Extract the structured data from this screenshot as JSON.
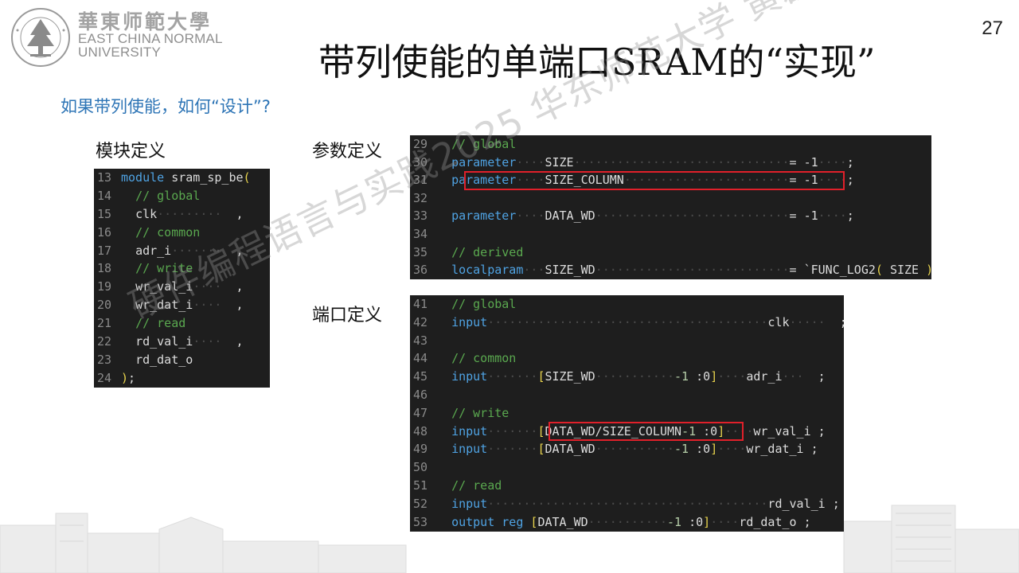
{
  "header": {
    "logo_cn": "華東师範大學",
    "logo_en_line1": "EAST CHINA NORMAL",
    "logo_en_line2": "UNIVERSITY",
    "page_number": "27"
  },
  "title": "带列使能的单端口SRAM的“实现”",
  "subtitle": "如果带列使能，如何“设计”?",
  "labels": {
    "module_def": "模块定义",
    "param_def": "参数定义",
    "port_def": "端口定义"
  },
  "watermark": "硬件编程语言与实践2025 华东师范大学 黄磊磊",
  "module_code": [
    {
      "ln": "13",
      "parts": [
        [
          "kw",
          "module "
        ],
        [
          "id",
          "sram_sp_be"
        ],
        [
          "yl",
          "("
        ]
      ]
    },
    {
      "ln": "14",
      "parts": [
        [
          "dots",
          "  "
        ],
        [
          "cm",
          "// global"
        ]
      ]
    },
    {
      "ln": "15",
      "parts": [
        [
          "dots",
          "  "
        ],
        [
          "id",
          "clk"
        ],
        [
          "dots",
          "·········"
        ],
        [
          "id",
          "  ,"
        ]
      ]
    },
    {
      "ln": "16",
      "parts": [
        [
          "dots",
          "  "
        ],
        [
          "cm",
          "// common"
        ]
      ]
    },
    {
      "ln": "17",
      "parts": [
        [
          "dots",
          "  "
        ],
        [
          "id",
          "adr_i"
        ],
        [
          "dots",
          "·······"
        ],
        [
          "id",
          "  ,"
        ]
      ]
    },
    {
      "ln": "18",
      "parts": [
        [
          "dots",
          "  "
        ],
        [
          "cm",
          "// write"
        ]
      ]
    },
    {
      "ln": "19",
      "parts": [
        [
          "dots",
          "  "
        ],
        [
          "id",
          "wr_val_i"
        ],
        [
          "dots",
          "····"
        ],
        [
          "id",
          "  ,"
        ]
      ]
    },
    {
      "ln": "20",
      "parts": [
        [
          "dots",
          "  "
        ],
        [
          "id",
          "wr_dat_i"
        ],
        [
          "dots",
          "····"
        ],
        [
          "id",
          "  ,"
        ]
      ]
    },
    {
      "ln": "21",
      "parts": [
        [
          "dots",
          "  "
        ],
        [
          "cm",
          "// read"
        ]
      ]
    },
    {
      "ln": "22",
      "parts": [
        [
          "dots",
          "  "
        ],
        [
          "id",
          "rd_val_i"
        ],
        [
          "dots",
          "····"
        ],
        [
          "id",
          "  ,"
        ]
      ]
    },
    {
      "ln": "23",
      "parts": [
        [
          "dots",
          "  "
        ],
        [
          "id",
          "rd_dat_o"
        ]
      ]
    },
    {
      "ln": "24",
      "parts": [
        [
          "yl",
          ")"
        ],
        [
          "id",
          ";"
        ]
      ]
    }
  ],
  "param_code": [
    {
      "ln": "29",
      "parts": [
        [
          "dots",
          "  "
        ],
        [
          "cm",
          "// global"
        ]
      ]
    },
    {
      "ln": "30",
      "parts": [
        [
          "dots",
          "  "
        ],
        [
          "kw",
          "parameter"
        ],
        [
          "dots",
          "····"
        ],
        [
          "id",
          "SIZE"
        ],
        [
          "dots",
          "······························"
        ],
        [
          "id",
          "= -1"
        ],
        [
          "dots",
          "····"
        ],
        [
          "id",
          ";"
        ]
      ]
    },
    {
      "ln": "31",
      "parts": [
        [
          "dots",
          "  "
        ],
        [
          "kw",
          "parameter"
        ],
        [
          "dots",
          "····"
        ],
        [
          "id",
          "SIZE_COLUMN"
        ],
        [
          "dots",
          "·······················"
        ],
        [
          "id",
          "= -1"
        ],
        [
          "dots",
          "····"
        ],
        [
          "id",
          ";"
        ]
      ]
    },
    {
      "ln": "32",
      "parts": []
    },
    {
      "ln": "33",
      "parts": [
        [
          "dots",
          "  "
        ],
        [
          "kw",
          "parameter"
        ],
        [
          "dots",
          "····"
        ],
        [
          "id",
          "DATA_WD"
        ],
        [
          "dots",
          "···························"
        ],
        [
          "id",
          "= -1"
        ],
        [
          "dots",
          "····"
        ],
        [
          "id",
          ";"
        ]
      ]
    },
    {
      "ln": "34",
      "parts": []
    },
    {
      "ln": "35",
      "parts": [
        [
          "dots",
          "  "
        ],
        [
          "cm",
          "// derived"
        ]
      ]
    },
    {
      "ln": "36",
      "parts": [
        [
          "dots",
          "  "
        ],
        [
          "kw",
          "localparam"
        ],
        [
          "dots",
          "···"
        ],
        [
          "id",
          "SIZE_WD"
        ],
        [
          "dots",
          "···························"
        ],
        [
          "id",
          "= `FUNC_LOG2"
        ],
        [
          "yl",
          "("
        ],
        [
          "id",
          " SIZE "
        ],
        [
          "yl",
          ")"
        ],
        [
          "id",
          " ;"
        ]
      ]
    }
  ],
  "port_code": [
    {
      "ln": "41",
      "parts": [
        [
          "dots",
          "  "
        ],
        [
          "cm",
          "// global"
        ]
      ]
    },
    {
      "ln": "42",
      "parts": [
        [
          "dots",
          "  "
        ],
        [
          "kw",
          "input"
        ],
        [
          "dots",
          "·······································"
        ],
        [
          "id",
          "clk"
        ],
        [
          "dots",
          "·····"
        ],
        [
          "id",
          "  ;"
        ]
      ]
    },
    {
      "ln": "43",
      "parts": []
    },
    {
      "ln": "44",
      "parts": [
        [
          "dots",
          "  "
        ],
        [
          "cm",
          "// common"
        ]
      ]
    },
    {
      "ln": "45",
      "parts": [
        [
          "dots",
          "  "
        ],
        [
          "kw",
          "input"
        ],
        [
          "dots",
          "·······"
        ],
        [
          "yl",
          "["
        ],
        [
          "id",
          "SIZE_WD"
        ],
        [
          "dots",
          "···········"
        ],
        [
          "num",
          "-1"
        ],
        [
          "id",
          " :0"
        ],
        [
          "yl",
          "]"
        ],
        [
          "dots",
          "····"
        ],
        [
          "id",
          "adr_i"
        ],
        [
          "dots",
          "···"
        ],
        [
          "id",
          "  ;"
        ]
      ]
    },
    {
      "ln": "46",
      "parts": []
    },
    {
      "ln": "47",
      "parts": [
        [
          "dots",
          "  "
        ],
        [
          "cm",
          "// write"
        ]
      ]
    },
    {
      "ln": "48",
      "parts": [
        [
          "dots",
          "  "
        ],
        [
          "kw",
          "input"
        ],
        [
          "dots",
          "·······"
        ],
        [
          "yl",
          "["
        ],
        [
          "id",
          "DATA_WD/SIZE_COLUMN"
        ],
        [
          "num",
          "-1"
        ],
        [
          "id",
          " :0"
        ],
        [
          "yl",
          "]"
        ],
        [
          "dots",
          "····"
        ],
        [
          "id",
          "wr_val_i"
        ],
        [
          "id",
          " ;"
        ]
      ]
    },
    {
      "ln": "49",
      "parts": [
        [
          "dots",
          "  "
        ],
        [
          "kw",
          "input"
        ],
        [
          "dots",
          "·······"
        ],
        [
          "yl",
          "["
        ],
        [
          "id",
          "DATA_WD"
        ],
        [
          "dots",
          "···········"
        ],
        [
          "num",
          "-1"
        ],
        [
          "id",
          " :0"
        ],
        [
          "yl",
          "]"
        ],
        [
          "dots",
          "····"
        ],
        [
          "id",
          "wr_dat_i"
        ],
        [
          "id",
          " ;"
        ]
      ]
    },
    {
      "ln": "50",
      "parts": []
    },
    {
      "ln": "51",
      "parts": [
        [
          "dots",
          "  "
        ],
        [
          "cm",
          "// read"
        ]
      ]
    },
    {
      "ln": "52",
      "parts": [
        [
          "dots",
          "  "
        ],
        [
          "kw",
          "input"
        ],
        [
          "dots",
          "·······································"
        ],
        [
          "id",
          "rd_val_i"
        ],
        [
          "id",
          " ;"
        ]
      ]
    },
    {
      "ln": "53",
      "parts": [
        [
          "dots",
          "  "
        ],
        [
          "kw",
          "output reg"
        ],
        [
          "dots",
          " "
        ],
        [
          "yl",
          "["
        ],
        [
          "id",
          "DATA_WD"
        ],
        [
          "dots",
          "···········"
        ],
        [
          "num",
          "-1"
        ],
        [
          "id",
          " :0"
        ],
        [
          "yl",
          "]"
        ],
        [
          "dots",
          "····"
        ],
        [
          "id",
          "rd_dat_o"
        ],
        [
          "id",
          " ;"
        ]
      ]
    }
  ],
  "colors": {
    "accent_blue": "#2e75b6",
    "highlight_red": "#e0202a",
    "code_bg": "#1e1e1e"
  }
}
